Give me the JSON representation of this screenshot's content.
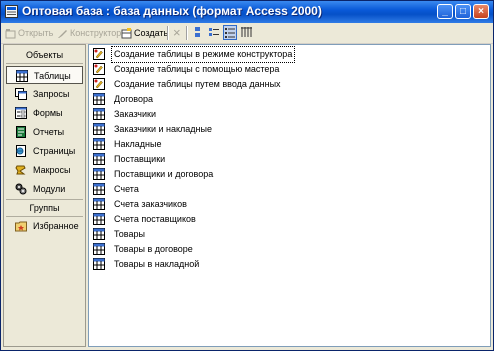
{
  "window": {
    "title": "Оптовая база : база данных (формат Access 2000)",
    "controls": {
      "minimize": "_",
      "maximize": "□",
      "close": "×"
    }
  },
  "toolbar": {
    "open_label": "Открыть",
    "design_label": "Конструктор",
    "create_label": "Создать",
    "delete_icon": "×"
  },
  "sidebar": {
    "objects_header": "Объекты",
    "items": [
      {
        "label": "Таблицы",
        "icon": "table-icon"
      },
      {
        "label": "Запросы",
        "icon": "query-icon"
      },
      {
        "label": "Формы",
        "icon": "form-icon"
      },
      {
        "label": "Отчеты",
        "icon": "report-icon"
      },
      {
        "label": "Страницы",
        "icon": "page-icon"
      },
      {
        "label": "Макросы",
        "icon": "macro-icon"
      },
      {
        "label": "Модули",
        "icon": "module-icon"
      }
    ],
    "groups_header": "Группы",
    "favorites_label": "Избранное",
    "selected": "Таблицы"
  },
  "list": {
    "items": [
      {
        "label": "Создание таблицы в режиме конструктора",
        "icon": "wizard-icon"
      },
      {
        "label": "Создание таблицы с помощью мастера",
        "icon": "wizard-icon"
      },
      {
        "label": "Создание таблицы путем ввода данных",
        "icon": "wizard-icon"
      },
      {
        "label": "Договора",
        "icon": "table-icon"
      },
      {
        "label": "Заказчики",
        "icon": "table-icon"
      },
      {
        "label": "Заказчики и накладные",
        "icon": "table-icon"
      },
      {
        "label": "Накладные",
        "icon": "table-icon"
      },
      {
        "label": "Поставщики",
        "icon": "table-icon"
      },
      {
        "label": "Поставщики и договора",
        "icon": "table-icon"
      },
      {
        "label": "Счета",
        "icon": "table-icon"
      },
      {
        "label": "Счета заказчиков",
        "icon": "table-icon"
      },
      {
        "label": "Счета поставщиков",
        "icon": "table-icon"
      },
      {
        "label": "Товары",
        "icon": "table-icon"
      },
      {
        "label": "Товары в договоре",
        "icon": "table-icon"
      },
      {
        "label": "Товары в накладной",
        "icon": "table-icon"
      }
    ],
    "focused": "Создание таблицы в режиме конструктора"
  },
  "colors": {
    "titlebar": "#0a5ad8",
    "selection": "#316ac5",
    "face": "#ece9d8"
  }
}
